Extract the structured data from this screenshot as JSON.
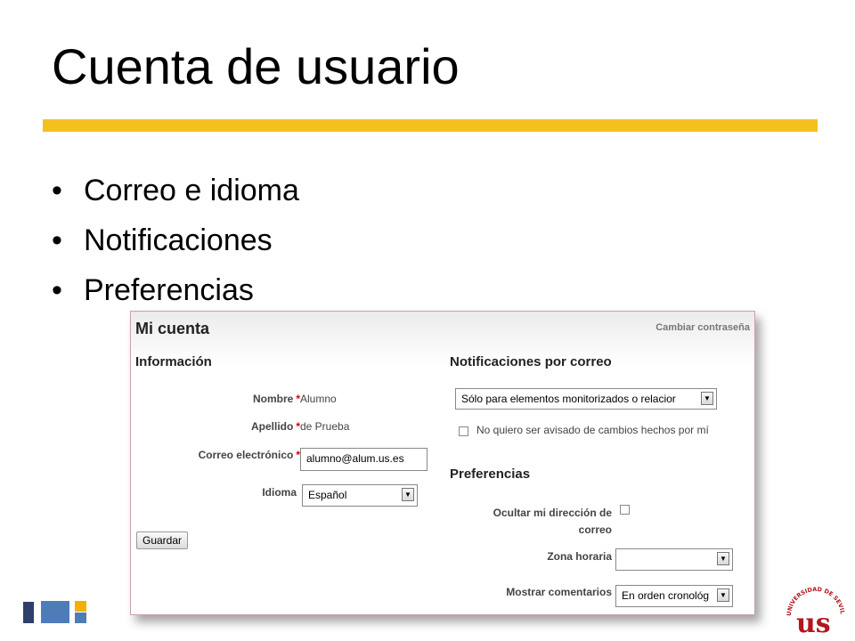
{
  "slide": {
    "title": "Cuenta de usuario",
    "bullets": [
      "Correo e idioma",
      "Notificaciones",
      "Preferencias"
    ]
  },
  "account": {
    "title": "Mi cuenta",
    "change_password": "Cambiar contraseña",
    "info_heading": "Información",
    "name_label": "Nombre",
    "name_value": "Alumno",
    "surname_label": "Apellido",
    "surname_value": "de Prueba",
    "email_label": "Correo electrónico",
    "email_value": "alumno@alum.us.es",
    "language_label": "Idioma",
    "language_value": "Español",
    "save_label": "Guardar",
    "required_mark": "*"
  },
  "notifications": {
    "heading": "Notificaciones por correo",
    "select_value": "Sólo para elementos monitorizados o relacior",
    "no_notify_label": "No quiero ser avisado de cambios hechos por mí"
  },
  "preferences": {
    "heading": "Preferencias",
    "hide_email_label_line1": "Ocultar mi dirección de",
    "hide_email_label_line2": "correo",
    "timezone_label": "Zona horaria",
    "timezone_value": "",
    "comments_label": "Mostrar comentarios",
    "comments_value": "En orden cronológ"
  },
  "logo": {
    "arc_text": "UNIVERSIDAD DE SEVILLA",
    "monogram": "us"
  },
  "colors": {
    "gold": "#f4c01e",
    "navy": "#2f3e6b",
    "blue": "#4e7cb8",
    "logo_red": "#b3161c"
  }
}
